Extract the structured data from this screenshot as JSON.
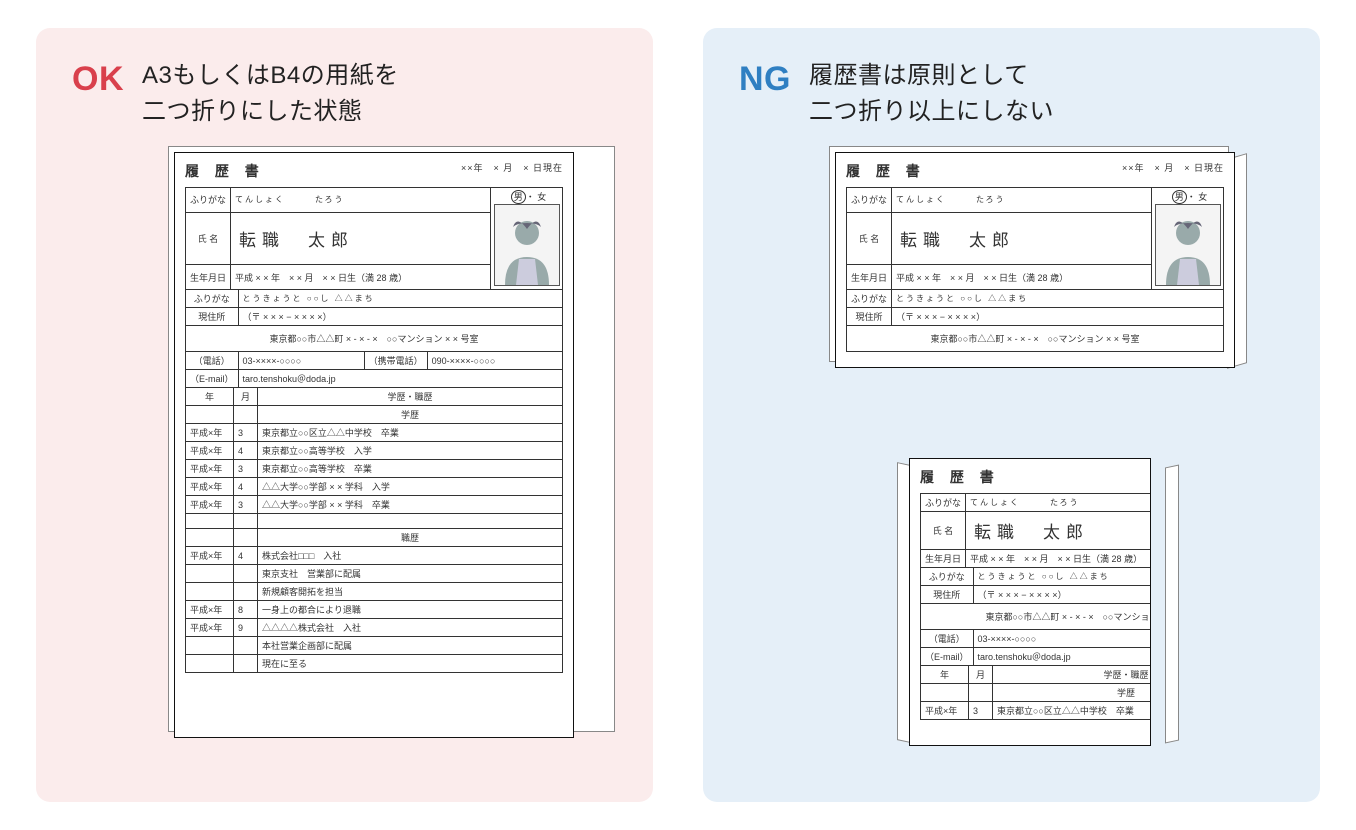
{
  "panels": {
    "ok": {
      "badge": "OK",
      "title_l1": "A3もしくはB4の用紙を",
      "title_l2": "二つ折りにした状態"
    },
    "ng": {
      "badge": "NG",
      "title_l1": "履歴書は原則として",
      "title_l2": "二つ折り以上にしない"
    }
  },
  "resume": {
    "title": "履 歴 書",
    "date": "××年　× 月　× 日現在",
    "furigana_label": "ふりがな",
    "name_furigana": "てんしょく　　　たろう",
    "name_label": "氏 名",
    "name": "転職　太郎",
    "gender": "男 ・ 女",
    "birth_label": "生年月日",
    "birth": "平成 × × 年　× × 月　× × 日生（満 28 歳）",
    "addr_furigana": "とうきょうと ○○し △△まち",
    "addr_label": "現住所",
    "postal": "（〒 × × × − × × × ×）",
    "address": "東京都○○市△△町 × - × - ×　○○マンション × × 号室",
    "tel_label": "（電話）",
    "tel": "03-××××-○○○○",
    "mobile_label": "（携帯電話）",
    "mobile": "090-××××-○○○○",
    "email_label": "（E-mail）",
    "email": "taro.tenshoku＠doda.jp",
    "col_year": "年",
    "col_month": "月",
    "col_hist": "学歴・職歴",
    "sec_edu": "学歴",
    "sec_work": "職歴",
    "rows_edu": [
      {
        "y": "平成×年",
        "m": "3",
        "t": "東京都立○○区立△△中学校　卒業"
      },
      {
        "y": "平成×年",
        "m": "4",
        "t": "東京都立○○高等学校　入学"
      },
      {
        "y": "平成×年",
        "m": "3",
        "t": "東京都立○○高等学校　卒業"
      },
      {
        "y": "平成×年",
        "m": "4",
        "t": "△△大学○○学部 × × 学科　入学"
      },
      {
        "y": "平成×年",
        "m": "3",
        "t": "△△大学○○学部 × × 学科　卒業"
      }
    ],
    "rows_work": [
      {
        "y": "平成×年",
        "m": "4",
        "t": "株式会社□□□　入社"
      },
      {
        "y": "",
        "m": "",
        "t": "東京支社　営業部に配属"
      },
      {
        "y": "",
        "m": "",
        "t": "新規顧客開拓を担当"
      },
      {
        "y": "平成×年",
        "m": "8",
        "t": "一身上の都合により退職"
      },
      {
        "y": "平成×年",
        "m": "9",
        "t": "△△△△株式会社　入社"
      },
      {
        "y": "",
        "m": "",
        "t": "本社営業企画部に配属"
      },
      {
        "y": "",
        "m": "",
        "t": "現在に至る"
      }
    ]
  }
}
